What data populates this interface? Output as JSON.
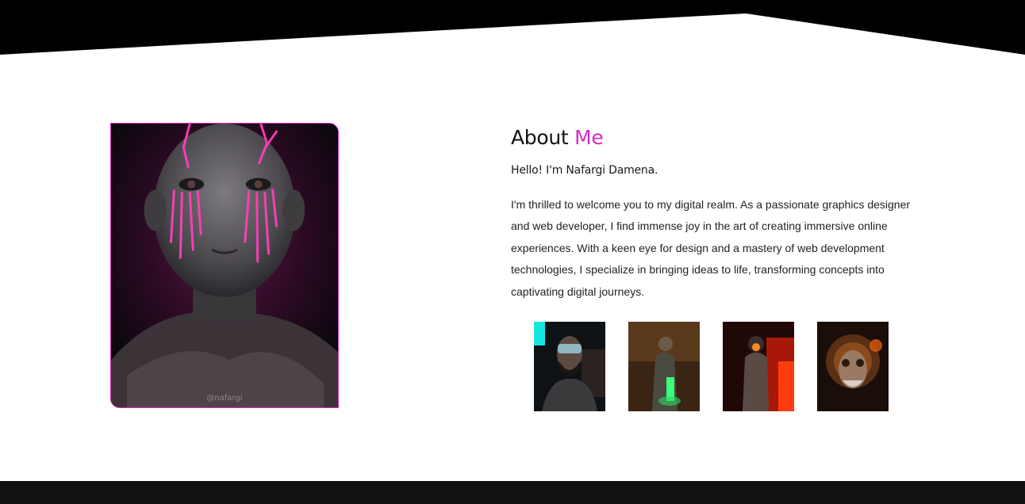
{
  "about": {
    "title_main": "About",
    "title_accent": "Me",
    "greeting": "Hello! I'm Nafargi Damena.",
    "bio": "I'm thrilled to welcome you to my digital realm. As a passionate graphics designer and web developer, I find immense joy in the art of creating immersive online experiences. With a keen eye for design and a mastery of web development technologies, I specialize in bringing ideas to life, transforming concepts into captivating digital journeys."
  },
  "portrait": {
    "watermark": "@nafargi",
    "subject": "neon-tear-child-portrait"
  },
  "gallery": [
    {
      "subject": "bearded-man-vr-headset"
    },
    {
      "subject": "soldier-green-glow"
    },
    {
      "subject": "gas-mask-figure-red"
    },
    {
      "subject": "old-man-steampunk"
    }
  ],
  "colors": {
    "accent": "#d62bc8",
    "header_band": "#000000",
    "footer_band": "#111111",
    "text": "#222222"
  }
}
